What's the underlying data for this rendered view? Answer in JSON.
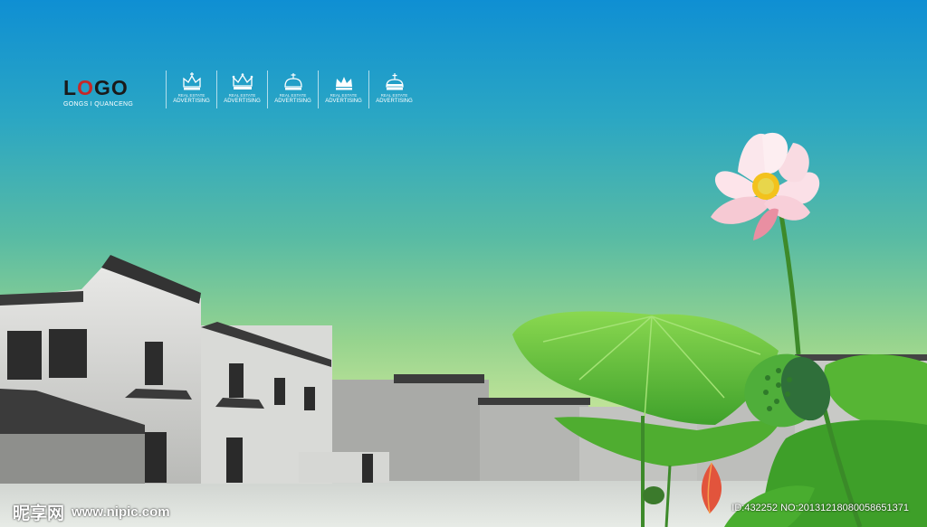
{
  "logo": {
    "pre": "L",
    "o": "O",
    "post": "GO",
    "subtitle": "GONGS I QUANCENG"
  },
  "badges": [
    {
      "line1": "REAL ESTATE",
      "line2": "ADVERTISING",
      "icon": "crown-icon"
    },
    {
      "line1": "REAL ESTATE",
      "line2": "ADVERTISING",
      "icon": "crown-icon"
    },
    {
      "line1": "REAL ESTATE",
      "line2": "ADVERTISING",
      "icon": "crown-icon"
    },
    {
      "line1": "REAL ESTATE",
      "line2": "ADVERTISING",
      "icon": "crown-icon"
    },
    {
      "line1": "REAL ESTATE",
      "line2": "ADVERTISING",
      "icon": "crown-icon"
    }
  ],
  "watermark": {
    "brand": "昵享网",
    "url": "www.nipic.com",
    "id": "ID:432252 NO:20131218080058651371"
  },
  "colors": {
    "sky_top": "#0f8fd3",
    "sky_bottom": "#d8eca9",
    "lotus_pink": "#f4a6b8",
    "leaf_green": "#5cbf3a",
    "logo_accent": "#c62828"
  }
}
